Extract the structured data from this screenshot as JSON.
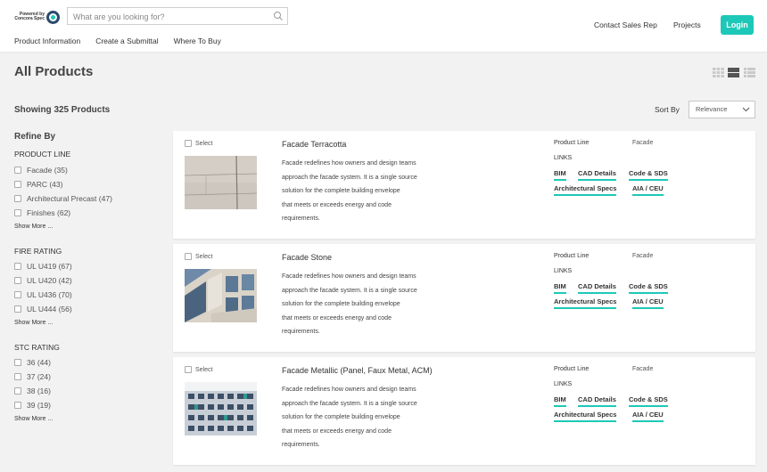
{
  "header": {
    "logo_text": "Powered by Concora Spec",
    "search_placeholder": "What are you looking for?",
    "nav": [
      "Product Information",
      "Create a Submittal",
      "Where To Buy"
    ],
    "contact": "Contact Sales Rep",
    "projects": "Projects",
    "login": "Login"
  },
  "page": {
    "title": "All Products",
    "showing": "Showing 325 Products",
    "sort_label": "Sort By",
    "sort_value": "Relevance"
  },
  "sidebar": {
    "refine": "Refine By",
    "facets": [
      {
        "title": "PRODUCT LINE",
        "items": [
          "Facade (35)",
          "PARC (43)",
          "Architectural Precast  (47)",
          "Finishes (62)"
        ],
        "more": "Show More ..."
      },
      {
        "title": "FIRE RATING",
        "items": [
          "UL U419 (67)",
          "UL U420 (42)",
          "UL U436 (70)",
          "UL U444 (56)"
        ],
        "more": "Show More ..."
      },
      {
        "title": "STC RATING",
        "items": [
          "36 (44)",
          "37 (24)",
          "38 (16)",
          "39 (19)"
        ],
        "more": "Show More ..."
      }
    ]
  },
  "products": [
    {
      "select": "Select",
      "name": "Facade Terracotta",
      "desc": [
        "Facade redefines how owners and design teams",
        "approach the facade system. It is a single source",
        "solution for the complete building envelope",
        "that meets or exceeds energy and code",
        "requirements."
      ],
      "pl_label": "Product Line",
      "pl_value": "Facade",
      "links_label": "LINKS",
      "links": [
        "BIM",
        "CAD Details",
        "Code & SDS",
        "Architectural Specs",
        "AIA / CEU"
      ]
    },
    {
      "select": "Select",
      "name": "Facade Stone",
      "desc": [
        "Facade redefines how owners and design teams",
        "approach the facade system. It is a single source",
        "solution for the complete building envelope",
        "that meets or exceeds energy and code",
        "requirements."
      ],
      "pl_label": "Product Line",
      "pl_value": "Facade",
      "links_label": "LINKS",
      "links": [
        "BIM",
        "CAD Details",
        "Code & SDS",
        "Architectural Specs",
        "AIA / CEU"
      ]
    },
    {
      "select": "Select",
      "name": "Facade Metallic (Panel, Faux Metal, ACM)",
      "desc": [
        "Facade redefines how owners and design teams",
        "approach the facade system. It is a single source",
        "solution for the complete building envelope",
        "that meets or exceeds energy and code",
        "requirements."
      ],
      "pl_label": "Product Line",
      "pl_value": "Facade",
      "links_label": "LINKS",
      "links": [
        "BIM",
        "CAD Details",
        "Code & SDS",
        "Architectural Specs",
        "AIA / CEU"
      ]
    }
  ],
  "colors": {
    "accent": "#1ec8b8",
    "brand_dark": "#2a4b6b"
  }
}
